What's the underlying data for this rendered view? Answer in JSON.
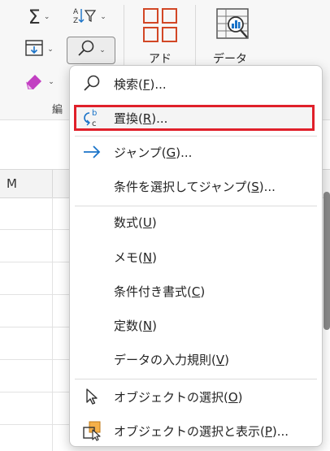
{
  "ribbon": {
    "sum_icon": "sigma-icon",
    "sort_icon": "sort-filter-icon",
    "fill_icon": "fill-down-icon",
    "find_icon": "magnifier-icon",
    "clear_icon": "eraser-icon",
    "addins_label": "アド",
    "data_analysis_label": "データ",
    "group_label": "編"
  },
  "sheet": {
    "column_letter": "M"
  },
  "menu": {
    "items": [
      {
        "label_pre": "検索(",
        "key": "F",
        "label_post": ")...",
        "icon": "search-icon"
      },
      {
        "label_pre": "置換(",
        "key": "R",
        "label_post": ")...",
        "icon": "replace-icon"
      },
      {
        "label_pre": "ジャンプ(",
        "key": "G",
        "label_post": ")...",
        "icon": "arrow-right-icon"
      },
      {
        "label_pre": "条件を選択してジャンプ(",
        "key": "S",
        "label_post": ")..."
      },
      {
        "label_pre": "数式(",
        "key": "U",
        "label_post": ")"
      },
      {
        "label_pre": "メモ(",
        "key": "N",
        "label_post": ")"
      },
      {
        "label_pre": "条件付き書式(",
        "key": "C",
        "label_post": ")"
      },
      {
        "label_pre": "定数(",
        "key": "N",
        "label_post": ")"
      },
      {
        "label_pre": "データの入力規則(",
        "key": "V",
        "label_post": ")"
      },
      {
        "label_pre": "オブジェクトの選択(",
        "key": "O",
        "label_post": ")",
        "icon": "pointer-icon"
      },
      {
        "label_pre": "オブジェクトの選択と表示(",
        "key": "P",
        "label_post": ")...",
        "icon": "selection-pane-icon"
      }
    ],
    "highlight_color": "#e0202a",
    "accent_color": "#1a73c8"
  }
}
